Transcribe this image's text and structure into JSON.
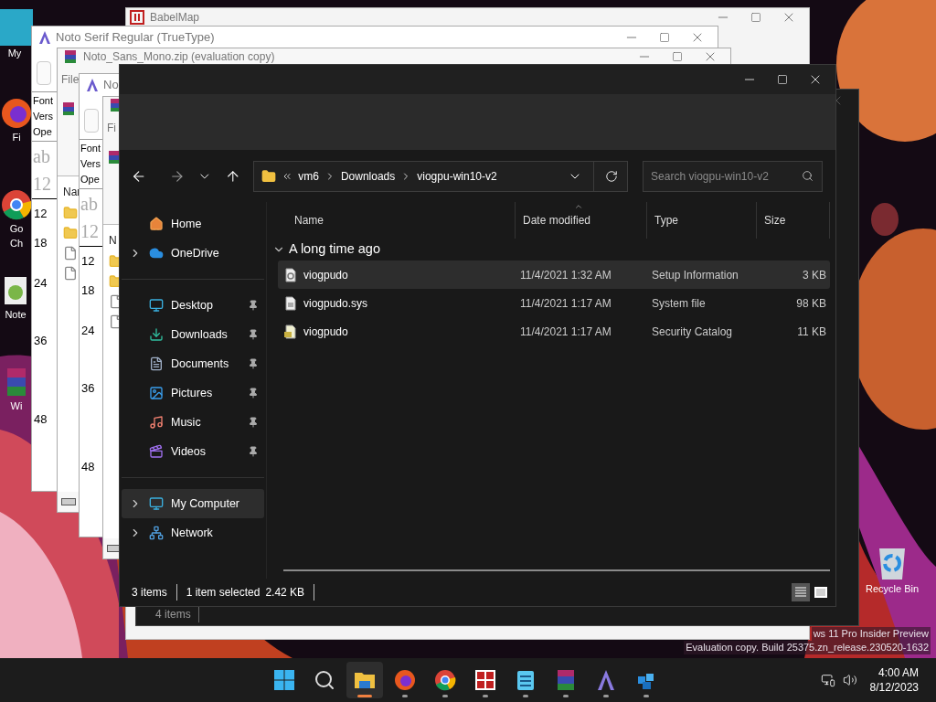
{
  "desktop_icons": [
    {
      "kind": "computer",
      "lines": [
        "My"
      ]
    },
    {
      "kind": "firefox",
      "lines": [
        "Fi"
      ]
    },
    {
      "kind": "chrome",
      "lines": [
        "Go",
        "Ch"
      ]
    },
    {
      "kind": "notepadpp",
      "lines": [
        "Note"
      ]
    },
    {
      "kind": "winrar",
      "lines": [
        "Wi"
      ]
    },
    {
      "kind": "recycle",
      "lines": [
        "Recycle Bin"
      ]
    }
  ],
  "watermark": [
    "ws 11 Pro Insider Preview",
    "Evaluation copy. Build 25375.zn_release.230520-1632"
  ],
  "background_windows": [
    {
      "kind": "babelmap",
      "title": "BabelMap"
    },
    {
      "kind": "fontview",
      "title": "Noto Serif Regular (TrueType)",
      "info": [
        "Font",
        "Vers",
        "Ope"
      ],
      "samples": [
        "ab",
        "12"
      ],
      "sizes": [
        "12",
        "18",
        "24",
        "36",
        "48"
      ]
    },
    {
      "kind": "archive",
      "title": "Noto_Sans_Mono.zip (evaluation copy)",
      "menu": "File",
      "header": "Nar"
    },
    {
      "kind": "fontview",
      "title": "No",
      "info": [
        "Font",
        "Vers",
        "Ope"
      ],
      "samples": [
        "ab",
        "12"
      ],
      "sizes": [
        "12",
        "18",
        "24",
        "36",
        "48"
      ]
    },
    {
      "kind": "archive",
      "menu": "Fi",
      "header": "N"
    },
    {
      "kind": "explorer",
      "status": "4 items"
    }
  ],
  "explorer": {
    "path": [
      "vm6",
      "Downloads",
      "viogpu-win10-v2"
    ],
    "search": {
      "placeholder": "Search viogpu-win10-v2"
    },
    "sidebar": [
      [
        {
          "label": "Home",
          "kind": "home",
          "expandable": false,
          "pinned": false,
          "selected": false
        },
        {
          "label": "OneDrive",
          "kind": "cloud",
          "expandable": true,
          "pinned": false,
          "selected": false
        }
      ],
      [
        {
          "label": "Desktop",
          "kind": "desktop",
          "expandable": false,
          "pinned": true,
          "selected": false
        },
        {
          "label": "Downloads",
          "kind": "downloads",
          "expandable": false,
          "pinned": true,
          "selected": false
        },
        {
          "label": "Documents",
          "kind": "documents",
          "expandable": false,
          "pinned": true,
          "selected": false
        },
        {
          "label": "Pictures",
          "kind": "pictures",
          "expandable": false,
          "pinned": true,
          "selected": false
        },
        {
          "label": "Music",
          "kind": "music",
          "expandable": false,
          "pinned": true,
          "selected": false
        },
        {
          "label": "Videos",
          "kind": "videos",
          "expandable": false,
          "pinned": true,
          "selected": false
        }
      ],
      [
        {
          "label": "My Computer",
          "kind": "computer",
          "expandable": true,
          "pinned": false,
          "selected": true
        },
        {
          "label": "Network",
          "kind": "network",
          "expandable": true,
          "pinned": false,
          "selected": false
        }
      ]
    ],
    "columns": [
      "Name",
      "Date modified",
      "Type",
      "Size"
    ],
    "group": {
      "label": "A long time ago",
      "expanded": true
    },
    "files": [
      {
        "name": "viogpudo",
        "date": "11/4/2021 1:32 AM",
        "type": "Setup Information",
        "size": "3 KB",
        "kind": "inf",
        "selected": true
      },
      {
        "name": "viogpudo.sys",
        "date": "11/4/2021 1:17 AM",
        "type": "System file",
        "size": "98 KB",
        "kind": "sys",
        "selected": false
      },
      {
        "name": "viogpudo",
        "date": "11/4/2021 1:17 AM",
        "type": "Security Catalog",
        "size": "11 KB",
        "kind": "cat",
        "selected": false
      }
    ],
    "status": [
      "3 items",
      "1 item selected",
      "2.42 KB"
    ],
    "view_buttons": [
      {
        "kind": "details",
        "selected": true
      },
      {
        "kind": "tiles",
        "selected": false
      }
    ]
  },
  "taskbar": {
    "items": [
      {
        "kind": "start",
        "open": false,
        "active": false
      },
      {
        "kind": "search",
        "open": false,
        "active": false
      },
      {
        "kind": "explorer",
        "open": true,
        "active": true
      },
      {
        "kind": "firefox",
        "open": true,
        "active": false
      },
      {
        "kind": "chrome",
        "open": true,
        "active": false
      },
      {
        "kind": "babelmap",
        "open": true,
        "active": false
      },
      {
        "kind": "notepad",
        "open": true,
        "active": false
      },
      {
        "kind": "winrar",
        "open": true,
        "active": false
      },
      {
        "kind": "fontview",
        "open": true,
        "active": false
      },
      {
        "kind": "cube",
        "open": true,
        "active": false
      }
    ],
    "time": "4:00 AM",
    "date": "8/12/2023"
  }
}
